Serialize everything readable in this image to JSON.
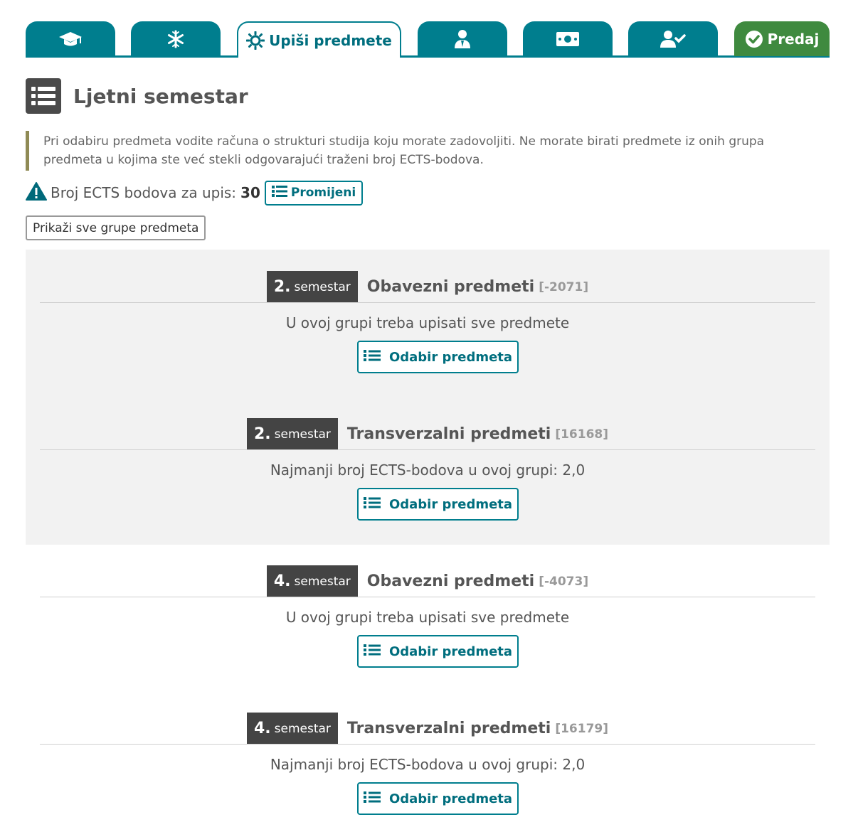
{
  "tabs": [
    {
      "icon": "graduation-cap-icon",
      "label": ""
    },
    {
      "icon": "snowflake-icon",
      "label": ""
    },
    {
      "icon": "sun-icon",
      "label": "Upiši predmete"
    },
    {
      "icon": "person-suit-icon",
      "label": ""
    },
    {
      "icon": "money-bill-icon",
      "label": ""
    },
    {
      "icon": "user-check-icon",
      "label": ""
    },
    {
      "icon": "check-circle-icon",
      "label": "Predaj"
    }
  ],
  "header": {
    "title": "Ljetni semestar",
    "icon": "list-icon"
  },
  "note": "Pri odabiru predmeta vodite računa o strukturi studija koju morate zadovoljiti. Ne morate birati predmete iz onih grupa predmeta u kojima ste već stekli odgovarajući traženi broj ECTS-bodova.",
  "ects": {
    "label": "Broj ECTS bodova za upis:",
    "value": "30",
    "change_label": "Promijeni"
  },
  "show_all_label": "Prikaži sve grupe predmeta",
  "groups": [
    {
      "sem_num": "2.",
      "sem_word": "semestar",
      "title": "Obavezni predmeti",
      "code": "[-2071]",
      "info": "U ovoj grupi treba upisati sve predmete",
      "button": "Odabir predmeta"
    },
    {
      "sem_num": "2.",
      "sem_word": "semestar",
      "title": "Transverzalni predmeti",
      "code": "[16168]",
      "info": "Najmanji broj ECTS-bodova u ovoj grupi: 2,0",
      "button": "Odabir predmeta"
    },
    {
      "sem_num": "4.",
      "sem_word": "semestar",
      "title": "Obavezni predmeti",
      "code": "[-4073]",
      "info": "U ovoj grupi treba upisati sve predmete",
      "button": "Odabir predmeta"
    },
    {
      "sem_num": "4.",
      "sem_word": "semestar",
      "title": "Transverzalni predmeti",
      "code": "[16179]",
      "info": "Najmanji broj ECTS-bodova u ovoj grupi: 2,0",
      "button": "Odabir predmeta"
    }
  ],
  "colors": {
    "teal": "#007e8e",
    "green": "#3f8a3f",
    "dark": "#444444",
    "highlight_bg": "#f2f2f2"
  }
}
